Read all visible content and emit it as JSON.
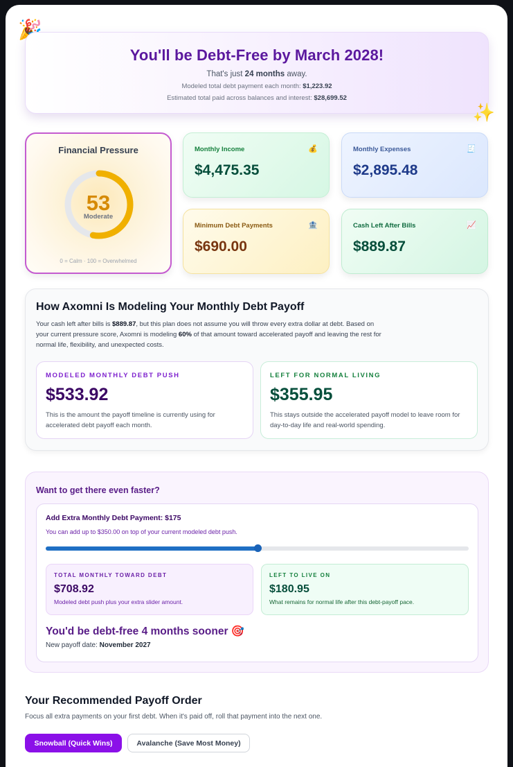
{
  "hero": {
    "party_icon": "🎉",
    "sparkle_icon": "✨",
    "title": "You'll be Debt-Free by March 2028!",
    "away_prefix": "That's just ",
    "away_months": "24 months",
    "away_suffix": " away.",
    "payment_prefix": "Modeled total debt payment each month: ",
    "payment_value": "$1,223.92",
    "total_prefix": "Estimated total paid across balances and interest: ",
    "total_value": "$28,699.52"
  },
  "pressure": {
    "title": "Financial Pressure",
    "score": "53",
    "score_value": 53,
    "level": "Moderate",
    "scale": "0 = Calm · 100 = Overwhelmed"
  },
  "stats": {
    "income": {
      "label": "Monthly Income",
      "value": "$4,475.35",
      "icon": "💰"
    },
    "expenses": {
      "label": "Monthly Expenses",
      "value": "$2,895.48",
      "icon": "🧾"
    },
    "minimum": {
      "label": "Minimum Debt Payments",
      "value": "$690.00",
      "icon": "🏦"
    },
    "cash_left": {
      "label": "Cash Left After Bills",
      "value": "$889.87",
      "icon": "📈"
    }
  },
  "modeling": {
    "title": "How Axomni Is Modeling Your Monthly Debt Payoff",
    "body_1": "Your cash left after bills is ",
    "body_cash": "$889.87",
    "body_2": ", but this plan does not assume you will throw every extra dollar at debt. Based on your current pressure score, Axomni is modeling ",
    "body_pct": "60%",
    "body_3": " of that amount toward accelerated payoff and leaving the rest for normal life, flexibility, and unexpected costs.",
    "push": {
      "kicker": "MODELED MONTHLY DEBT PUSH",
      "value": "$533.92",
      "note": "This is the amount the payoff timeline is currently using for accelerated debt payoff each month."
    },
    "living": {
      "kicker": "LEFT FOR NORMAL LIVING",
      "value": "$355.95",
      "note": "This stays outside the accelerated payoff model to leave room for day-to-day life and real-world spending."
    }
  },
  "faster": {
    "title": "Want to get there even faster?",
    "extra_label": "Add Extra Monthly Debt Payment: $175",
    "extra_sub": "You can add up to $350.00 on top of your current modeled debt push.",
    "slider_value": 175,
    "slider_max": 350,
    "total": {
      "kicker": "TOTAL MONTHLY TOWARD DEBT",
      "value": "$708.92",
      "note": "Modeled debt push plus your extra slider amount."
    },
    "live": {
      "kicker": "LEFT TO LIVE ON",
      "value": "$180.95",
      "note": "What remains for normal life after this debt-payoff pace."
    },
    "sooner_text": "You'd be debt-free 4 months sooner",
    "target_icon": "🎯",
    "newdate_prefix": "New payoff date: ",
    "newdate_value": "November 2027"
  },
  "payoff": {
    "title": "Your Recommended Payoff Order",
    "subtitle": "Focus all extra payments on your first debt. When it's paid off, roll that payment into the next one.",
    "snowball_label": "Snowball (Quick Wins)",
    "avalanche_label": "Avalanche (Save Most Money)"
  },
  "colors": {
    "accent_purple": "#8b10e8",
    "gauge_amber": "#f0b000",
    "slider_blue": "#1f6fc4"
  }
}
